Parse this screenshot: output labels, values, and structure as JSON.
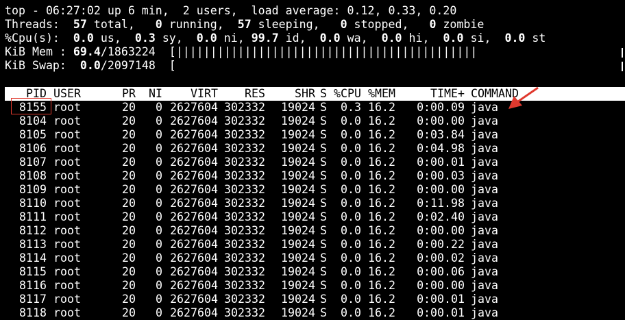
{
  "summary": {
    "top_line": "top - 06:27:02 up 6 min,  2 users,  load average: 0.12, 0.33, 0.20",
    "threads_parts": [
      "Threads:  ",
      "57",
      " total,   ",
      "0",
      " running,  ",
      "57",
      " sleeping,   ",
      "0",
      " stopped,   ",
      "0",
      " zombie"
    ],
    "cpu_parts": [
      "%Cpu(s):  ",
      "0.0",
      " us,  ",
      "0.3",
      " sy,  ",
      "0.0",
      " ni, ",
      "99.7",
      " id,  ",
      "0.0",
      " wa,  ",
      "0.0",
      " hi,  ",
      "0.0",
      " si,  ",
      "0.0",
      " st"
    ],
    "mem_parts": [
      "KiB Mem : ",
      "69.4",
      "/1863224  [||||||||||||||||||||||||||||||||||||||||||||"
    ],
    "swap_parts": [
      "KiB Swap:  ",
      "0.0",
      "/2097148  ["
    ]
  },
  "columns": [
    "PID",
    "USER",
    "PR",
    "NI",
    "VIRT",
    "RES",
    "SHR",
    "S",
    "%CPU",
    "%MEM",
    "TIME+",
    "COMMAND"
  ],
  "processes": [
    [
      "8155",
      "root",
      "20",
      "0",
      "2627604",
      "302332",
      "19024",
      "S",
      "0.3",
      "16.2",
      "0:00.09",
      "java"
    ],
    [
      "8104",
      "root",
      "20",
      "0",
      "2627604",
      "302332",
      "19024",
      "S",
      "0.0",
      "16.2",
      "0:00.00",
      "java"
    ],
    [
      "8105",
      "root",
      "20",
      "0",
      "2627604",
      "302332",
      "19024",
      "S",
      "0.0",
      "16.2",
      "0:03.84",
      "java"
    ],
    [
      "8106",
      "root",
      "20",
      "0",
      "2627604",
      "302332",
      "19024",
      "S",
      "0.0",
      "16.2",
      "0:04.98",
      "java"
    ],
    [
      "8107",
      "root",
      "20",
      "0",
      "2627604",
      "302332",
      "19024",
      "S",
      "0.0",
      "16.2",
      "0:00.01",
      "java"
    ],
    [
      "8108",
      "root",
      "20",
      "0",
      "2627604",
      "302332",
      "19024",
      "S",
      "0.0",
      "16.2",
      "0:00.03",
      "java"
    ],
    [
      "8109",
      "root",
      "20",
      "0",
      "2627604",
      "302332",
      "19024",
      "S",
      "0.0",
      "16.2",
      "0:00.00",
      "java"
    ],
    [
      "8110",
      "root",
      "20",
      "0",
      "2627604",
      "302332",
      "19024",
      "S",
      "0.0",
      "16.2",
      "0:11.98",
      "java"
    ],
    [
      "8111",
      "root",
      "20",
      "0",
      "2627604",
      "302332",
      "19024",
      "S",
      "0.0",
      "16.2",
      "0:02.40",
      "java"
    ],
    [
      "8112",
      "root",
      "20",
      "0",
      "2627604",
      "302332",
      "19024",
      "S",
      "0.0",
      "16.2",
      "0:00.00",
      "java"
    ],
    [
      "8113",
      "root",
      "20",
      "0",
      "2627604",
      "302332",
      "19024",
      "S",
      "0.0",
      "16.2",
      "0:00.22",
      "java"
    ],
    [
      "8114",
      "root",
      "20",
      "0",
      "2627604",
      "302332",
      "19024",
      "S",
      "0.0",
      "16.2",
      "0:00.02",
      "java"
    ],
    [
      "8115",
      "root",
      "20",
      "0",
      "2627604",
      "302332",
      "19024",
      "S",
      "0.0",
      "16.2",
      "0:00.06",
      "java"
    ],
    [
      "8116",
      "root",
      "20",
      "0",
      "2627604",
      "302332",
      "19024",
      "S",
      "0.0",
      "16.2",
      "0:00.00",
      "java"
    ],
    [
      "8117",
      "root",
      "20",
      "0",
      "2627604",
      "302332",
      "19024",
      "S",
      "0.0",
      "16.2",
      "0:00.01",
      "java"
    ],
    [
      "8118",
      "root",
      "20",
      "0",
      "2627604",
      "302332",
      "19024",
      "S",
      "0.0",
      "16.2",
      "0:00.01",
      "java"
    ]
  ],
  "colors": {
    "background": "#000000",
    "foreground": "#ffffff",
    "annotation": "#e0392e"
  }
}
